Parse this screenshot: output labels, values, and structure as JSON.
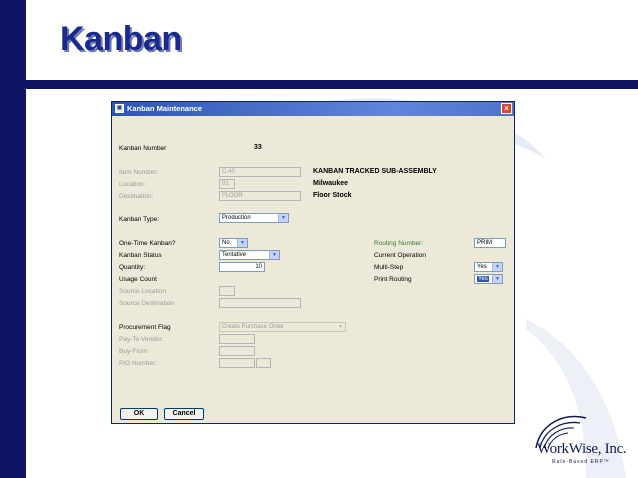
{
  "slide": {
    "title": "Kanban",
    "logo": {
      "name": "WorkWise, Inc.",
      "tagline": "Rule-Based ERP™"
    }
  },
  "dialog": {
    "title": "Kanban Maintenance",
    "kanban_number": {
      "label": "Kanban Number",
      "value": "33"
    },
    "item_number": {
      "label": "Item Number:",
      "value": "C-40",
      "description": "KANBAN TRACKED SUB-ASSEMBLY"
    },
    "location": {
      "label": "Location:",
      "value": "01",
      "description": "Milwaukee"
    },
    "destination": {
      "label": "Destination:",
      "value": "FLOOR",
      "description": "Floor Stock"
    },
    "kanban_type": {
      "label": "Kanban Type:",
      "value": "Production"
    },
    "one_time": {
      "label": "One-Time Kanban?",
      "value": "No"
    },
    "status": {
      "label": "Kanban Status",
      "value": "Tentative"
    },
    "quantity": {
      "label": "Quantity:",
      "value": "10"
    },
    "usage_count": {
      "label": "Usage Count"
    },
    "source_location": {
      "label": "Source Location",
      "value": ""
    },
    "source_destination": {
      "label": "Source Destination",
      "value": ""
    },
    "procurement": {
      "label": "Procurement Flag",
      "value": "Create Purchase Order"
    },
    "pay_to_vendor": {
      "label": "Pay-To Vendor:",
      "value": ""
    },
    "buy_from": {
      "label": "Buy-From",
      "value": ""
    },
    "po_number": {
      "label": "P/O Number:",
      "value": ""
    },
    "routing_number": {
      "label": "Routing Number:",
      "value": "PRIM"
    },
    "current_operation": {
      "label": "Current Operation"
    },
    "multi_step": {
      "label": "Multi-Step",
      "value": "Yes"
    },
    "print_routing": {
      "label": "Print Routing",
      "value": "Yes"
    },
    "buttons": {
      "ok": "OK",
      "cancel": "Cancel"
    }
  },
  "colors": {
    "accent": "#0f1563",
    "title": "#1a2a8c",
    "routing_label": "#2e7d32"
  }
}
